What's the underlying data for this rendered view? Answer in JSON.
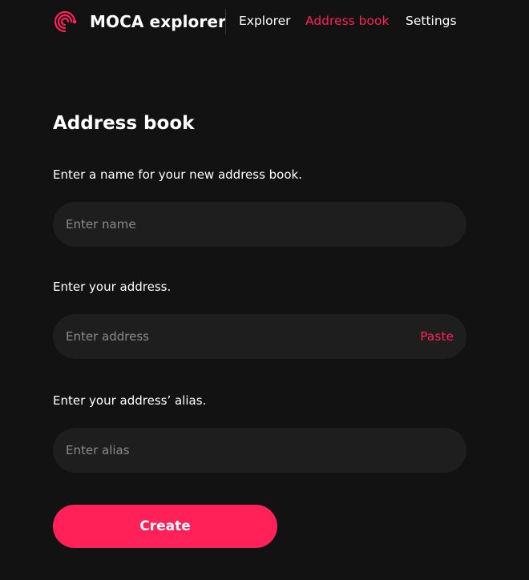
{
  "header": {
    "app_title": "MOCA explorer",
    "logo_icon": "spiral-logo-icon",
    "nav": [
      {
        "label": "Explorer",
        "active": false
      },
      {
        "label": "Address book",
        "active": true
      },
      {
        "label": "Settings",
        "active": false
      }
    ]
  },
  "page": {
    "title": "Address book"
  },
  "form": {
    "name_label": "Enter a name for your new address book.",
    "name_placeholder": "Enter name",
    "name_value": "",
    "address_label": "Enter your address.",
    "address_placeholder": "Enter address",
    "address_value": "",
    "paste_label": "Paste",
    "alias_label": "Enter your address’ alias.",
    "alias_placeholder": "Enter alias",
    "alias_value": "",
    "create_label": "Create"
  },
  "colors": {
    "accent": "#ff2157",
    "background": "#121212",
    "input_background": "#1e1e1e",
    "placeholder": "#8b8b8b"
  }
}
